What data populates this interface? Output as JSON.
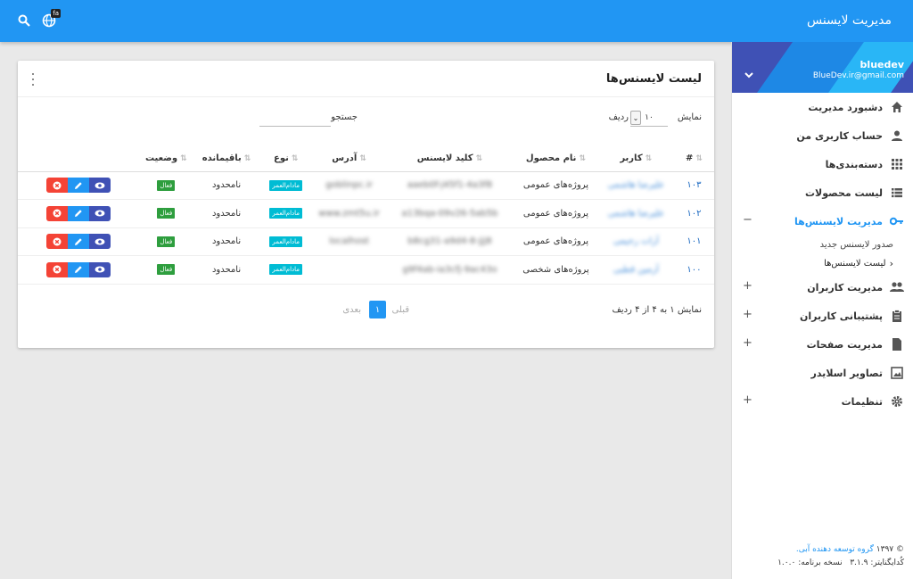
{
  "app": {
    "title": "مدیریت لایسنس"
  },
  "topbar": {
    "lang_badge": "fa"
  },
  "colors": {
    "primary": "#2196f3",
    "danger": "#f44336",
    "indigo": "#3f51b5",
    "success": "#2e9e3e",
    "cyan": "#00bcd4"
  },
  "profile": {
    "name": "bluedev",
    "email": "BlueDev.ir@gmail.com"
  },
  "sidebar": {
    "items": [
      {
        "label": "دشبورد مدیریت",
        "icon": "home-icon"
      },
      {
        "label": "حساب کاربری من",
        "icon": "person-icon"
      },
      {
        "label": "دسته‌بندی‌ها",
        "icon": "grid-icon"
      },
      {
        "label": "لیست محصولات",
        "icon": "list-icon"
      },
      {
        "label": "مدیریت لایسنس‌ها",
        "icon": "key-icon",
        "toggle": "−"
      },
      {
        "label": "مدیریت کاربران",
        "icon": "people-icon",
        "toggle": "+"
      },
      {
        "label": "پشتیبانی کاربران",
        "icon": "clipboard-icon",
        "toggle": "+"
      },
      {
        "label": "مدیریت صفحات",
        "icon": "file-icon",
        "toggle": "+"
      },
      {
        "label": "تصاویر اسلایدر",
        "icon": "image-icon"
      },
      {
        "label": "تنظیمات",
        "icon": "gear-icon",
        "toggle": "+"
      }
    ],
    "subitems": [
      {
        "label": "صدور لایسنس جدید"
      },
      {
        "label": "لیست لایسنس‌ها"
      }
    ],
    "footer": {
      "copyright": "© ۱۳۹۷",
      "org": "گروه توسعه دهنده آبی.",
      "builder_label": "کُدایگنایتر:",
      "builder_version": "۳.۱.۹",
      "version_label": "نسخه برنامه:",
      "version": "۱.۰.۰"
    }
  },
  "card": {
    "title": "لیست لایسنس‌ها"
  },
  "controls": {
    "show_label": "نمایش",
    "page_length": "۱۰",
    "rows_label": "ردیف",
    "search_label": "جستجو",
    "search_value": ""
  },
  "table": {
    "headers": [
      "#",
      "کاربر",
      "نام محصول",
      "کلید لایسنس",
      "آدرس",
      "نوع",
      "باقیمانده",
      "وضعیت"
    ],
    "rows": [
      {
        "id": "۱۰۳",
        "user": "علیرضا هاشمی",
        "product": "پروژه‌های عمومی",
        "key": "aaeb0f-j45f1-4a3f8",
        "address": "goblinpc.ir",
        "type": "مادام‌العمر",
        "remaining": "نامحدود",
        "status": "فعال"
      },
      {
        "id": "۱۰۲",
        "user": "علیرضا هاشمی",
        "product": "پروژه‌های عمومی",
        "key": "a13bqa-09v26-5ab5b",
        "address": "www.zmt5u.ir",
        "type": "مادام‌العمر",
        "remaining": "نامحدود",
        "status": "فعال"
      },
      {
        "id": "۱۰۱",
        "user": "آرات رحیمی",
        "product": "پروژه‌های عمومی",
        "key": "b8cg31-a9d4-8-jjj8",
        "address": "localhost",
        "type": "مادام‌العمر",
        "remaining": "نامحدود",
        "status": "فعال"
      },
      {
        "id": "۱۰۰",
        "user": "آرمین قطبی",
        "product": "پروژه‌های شخصی",
        "key": "g9f4ab-ia3cfj-9ac43o",
        "address": "",
        "type": "مادام‌العمر",
        "remaining": "نامحدود",
        "status": "فعال"
      }
    ]
  },
  "pagination": {
    "info": "نمایش ۱ به ۴ از ۴ ردیف",
    "prev": "قبلی",
    "current": "۱",
    "next": "بعدی"
  }
}
